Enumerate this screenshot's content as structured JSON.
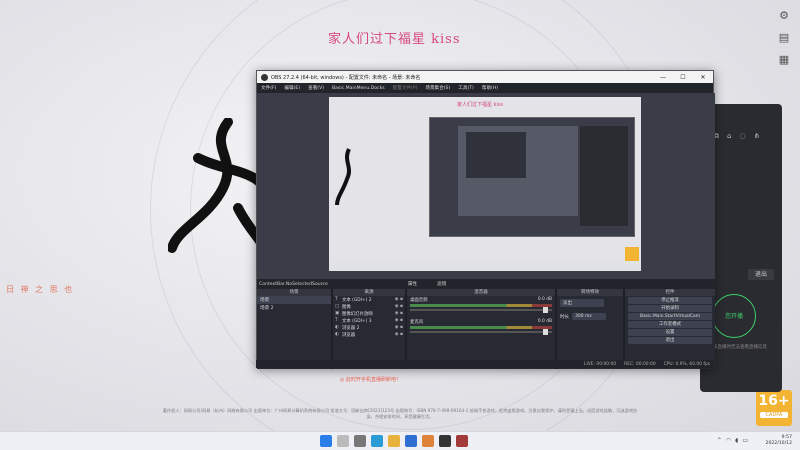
{
  "background": {
    "title": "家人们过下福星 kiss",
    "left_text": "日 神 之 思 也",
    "legal_text": "著作权人：网易公司(网易（杭州）网络有限公司 出版单位：广州网易计算机系统有限公司 批准文号：国新出审[2023]123号 出版物号：ISBN 978-7-498-09164-1 抵制不良游戏，拒绝盗版游戏。注意自我保护，谨防受骗上当。适度游戏益脑，沉迷游戏伤身。合理安排时间，享受健康生活。",
    "age_badge": {
      "number": "16+",
      "caption": "CADPA"
    }
  },
  "side_panel": {
    "record_button": "退出",
    "circle_label": "您开播",
    "hint": "未直播时无法查看直播信息"
  },
  "obs": {
    "title": "OBS 27.2.4 (64-bit, windows) - 配置文件: 未命名 - 场景: 未命名",
    "menu": [
      "文件(F)",
      "编辑(E)",
      "查看(V)",
      "Basic.MainMenu.Docks",
      "配置文件(P)",
      "场景集合(S)",
      "工具(T)",
      "帮助(H)"
    ],
    "preview_title": "家人们过下福星 kiss",
    "scene_info_bar": [
      "ContextBar.NoSelectedSource",
      "属性",
      "滤镜"
    ],
    "docks": {
      "scenes": {
        "header": "场景",
        "items": [
          "场景",
          "场景 2"
        ]
      },
      "sources": {
        "header": "来源",
        "items": [
          {
            "icon": "T",
            "label": "文本 (GDI+) 2"
          },
          {
            "icon": "□",
            "label": "图像"
          },
          {
            "icon": "▣",
            "label": "图像幻灯片放映"
          },
          {
            "icon": "T",
            "label": "文本 (GDI+) 3"
          },
          {
            "icon": "◐",
            "label": "浏览器 2"
          },
          {
            "icon": "◐",
            "label": "浏览器"
          }
        ]
      },
      "mixer": {
        "header": "混音器",
        "channels": [
          {
            "name": "桌面音频",
            "db": "0.0 dB"
          },
          {
            "name": "麦克风",
            "db": "0.0 dB"
          }
        ]
      },
      "transitions": {
        "header": "转场特效",
        "type": "淡出",
        "duration_label": "时长",
        "duration": "300 ms"
      },
      "controls": {
        "header": "控件",
        "buttons": [
          "停止推流",
          "开始录制",
          "Basic.Main.StartVirtualCam",
          "工作室模式",
          "设置",
          "退出"
        ]
      }
    },
    "status": [
      "LIVE: 00:00:00",
      "REC: 00:00:00",
      "CPU: 0.9%, 60.00 fps"
    ]
  },
  "notice": "◎ 此时开手机直播刷新吧！",
  "taskbar": {
    "time": "9:57",
    "date": "2022/10/12"
  },
  "colors": {
    "accent_pink": "#d7477f",
    "live_green": "#3fcf6a",
    "badge_orange": "#f3b434"
  }
}
